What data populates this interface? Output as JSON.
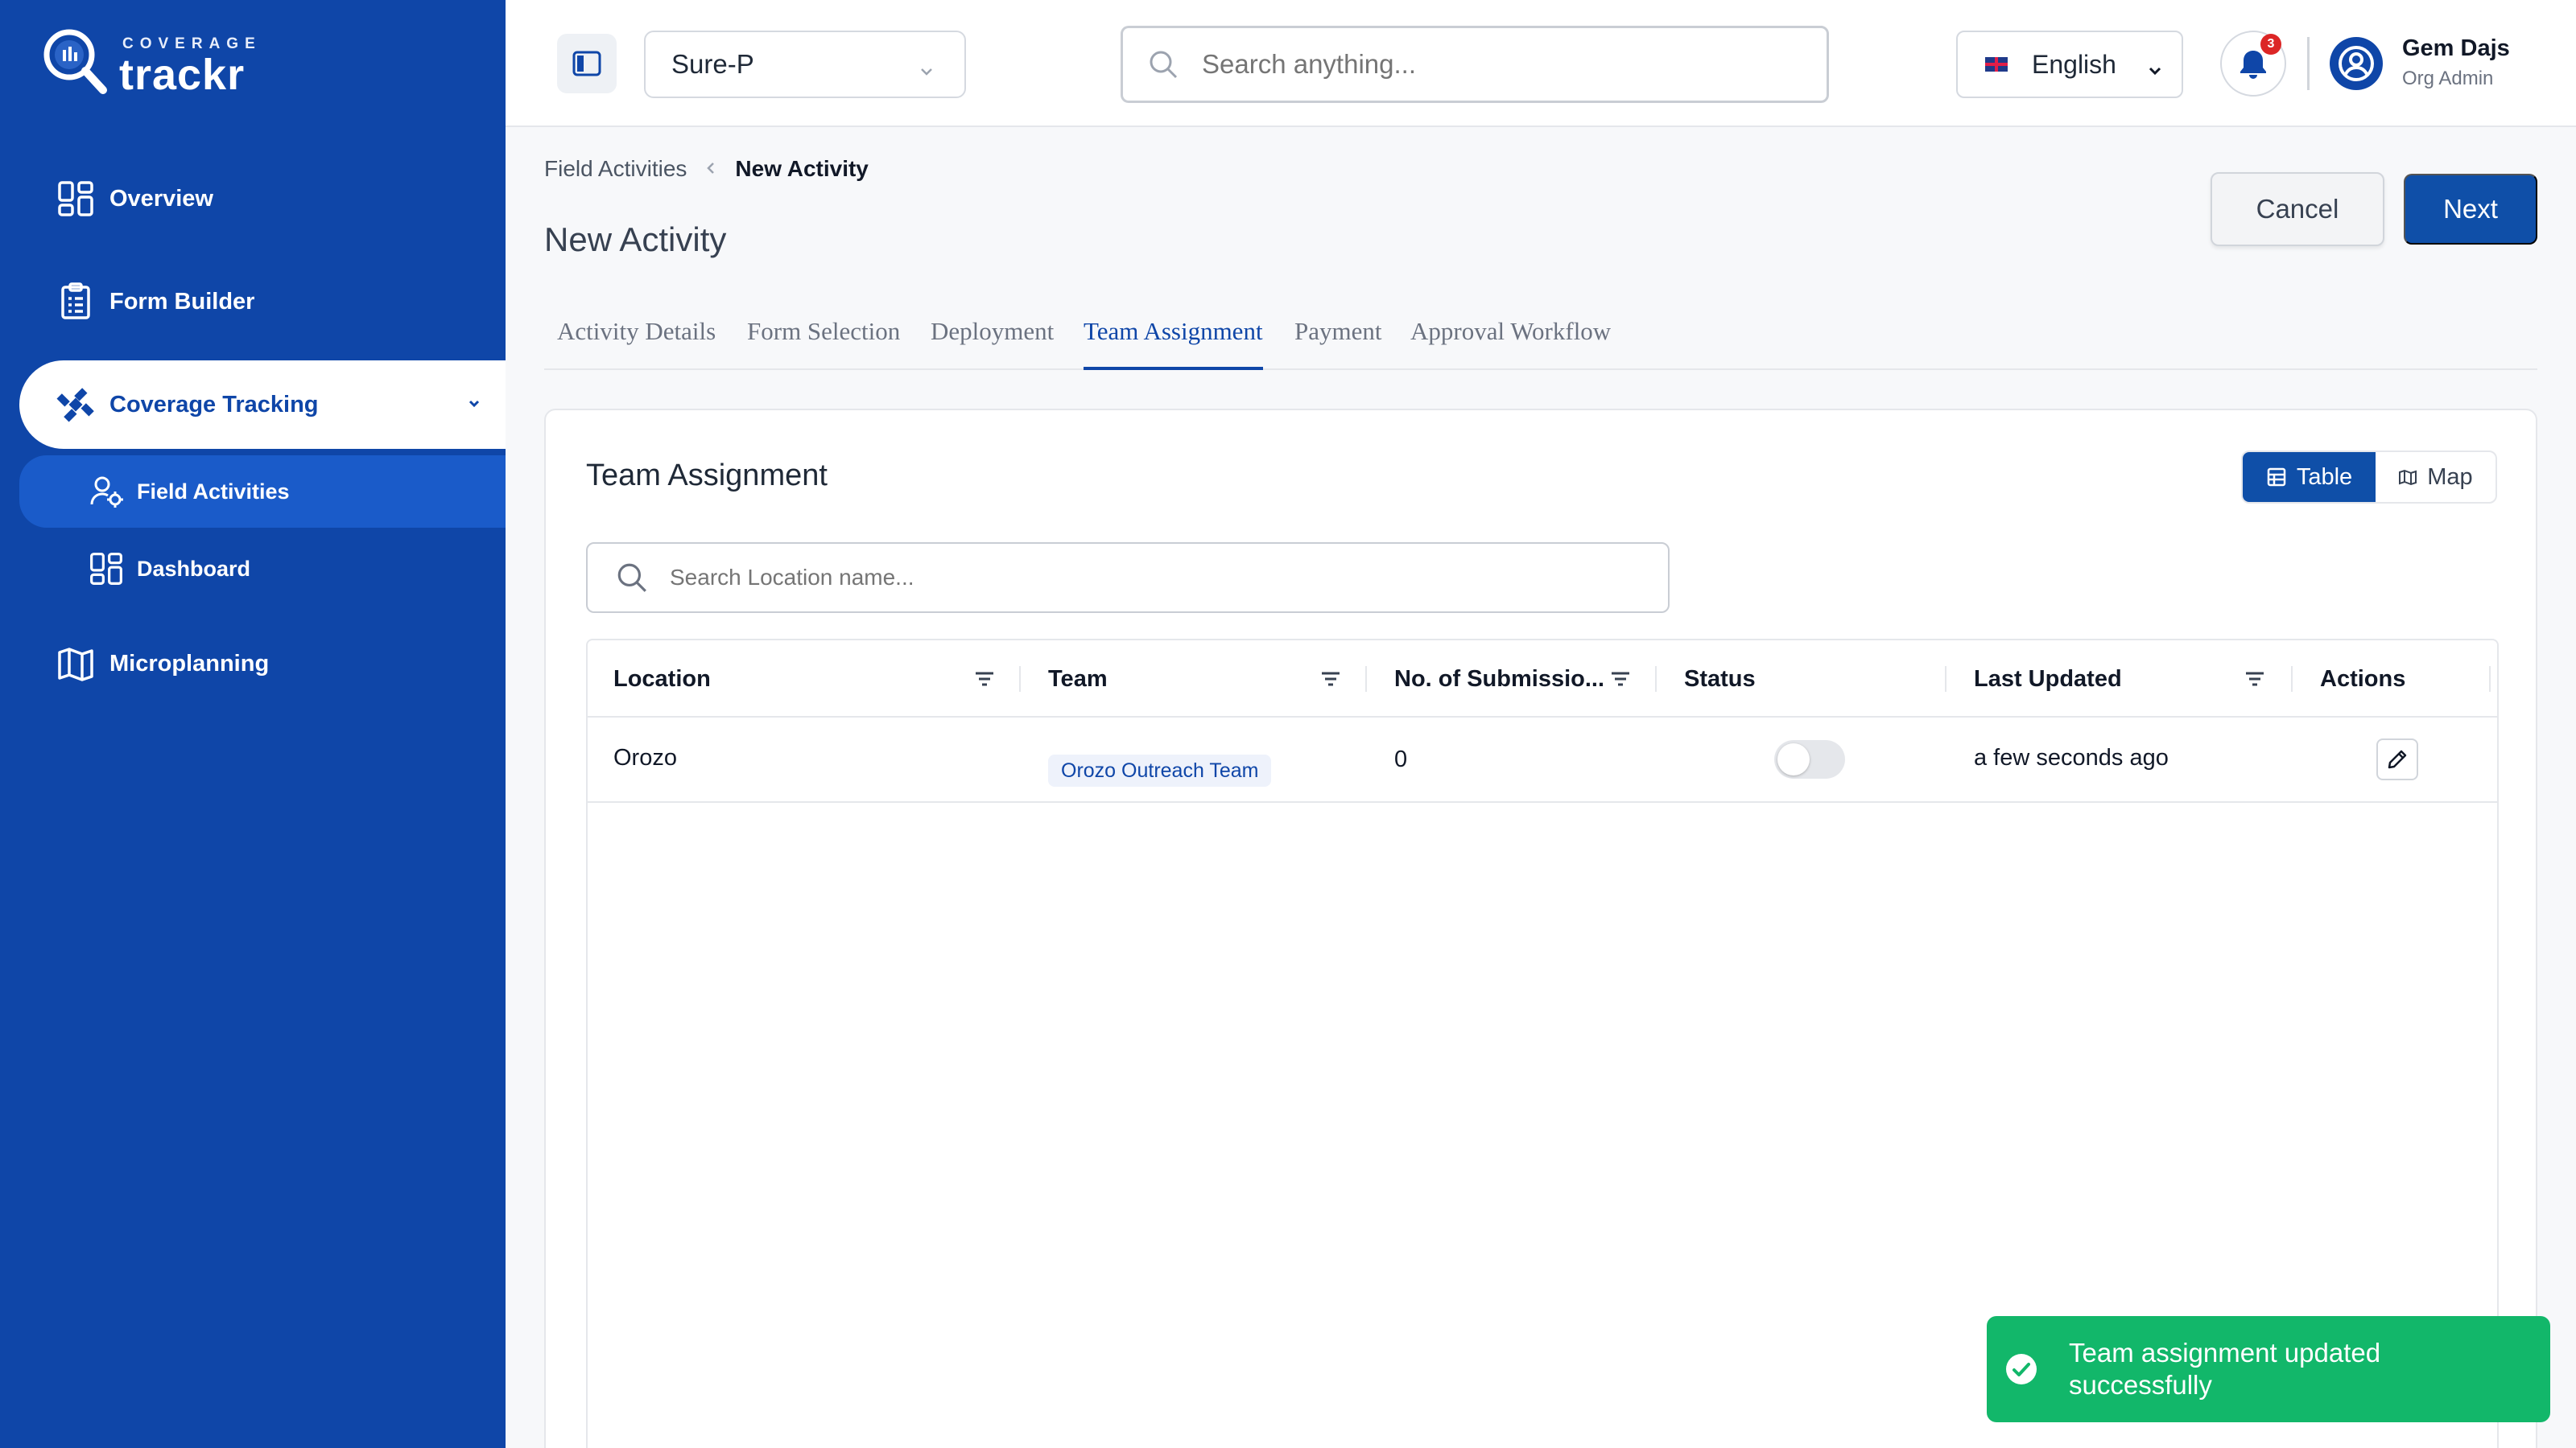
{
  "brand": {
    "small": "COVERAGE",
    "name": "trackr"
  },
  "sidebar": {
    "items": [
      {
        "label": "Overview",
        "icon": "grid-icon"
      },
      {
        "label": "Form Builder",
        "icon": "clipboard-icon"
      },
      {
        "label": "Coverage Tracking",
        "icon": "satellite-icon"
      },
      {
        "label": "Microplanning",
        "icon": "map-icon"
      }
    ],
    "sub_items": [
      {
        "label": "Field Activities",
        "icon": "user-gear-icon"
      },
      {
        "label": "Dashboard",
        "icon": "grid-icon"
      }
    ]
  },
  "header": {
    "org_select": "Sure-P",
    "search_placeholder": "Search anything...",
    "language": "English",
    "notification_count": "3",
    "user_name": "Gem Dajs",
    "user_role": "Org Admin"
  },
  "breadcrumb": {
    "parent": "Field Activities",
    "current": "New Activity"
  },
  "page_title": "New Activity",
  "actions": {
    "cancel": "Cancel",
    "next": "Next"
  },
  "tabs": [
    "Activity Details",
    "Form Selection",
    "Deployment",
    "Team Assignment",
    "Payment",
    "Approval Workflow"
  ],
  "active_tab": "Team Assignment",
  "card": {
    "title": "Team Assignment",
    "view_table": "Table",
    "view_map": "Map",
    "search_placeholder": "Search Location name..."
  },
  "table": {
    "columns": [
      "Location",
      "Team",
      "No. of Submissio...",
      "Status",
      "Last Updated",
      "Actions"
    ],
    "rows": [
      {
        "location": "Orozo",
        "team": "Orozo Outreach Team",
        "submissions": "0",
        "status_on": false,
        "last_updated": "a few seconds ago"
      }
    ]
  },
  "toast": {
    "message": "Team assignment updated successfully"
  },
  "colors": {
    "primary": "#0f46a8",
    "success": "#12b76a",
    "badge": "#dc2626"
  }
}
